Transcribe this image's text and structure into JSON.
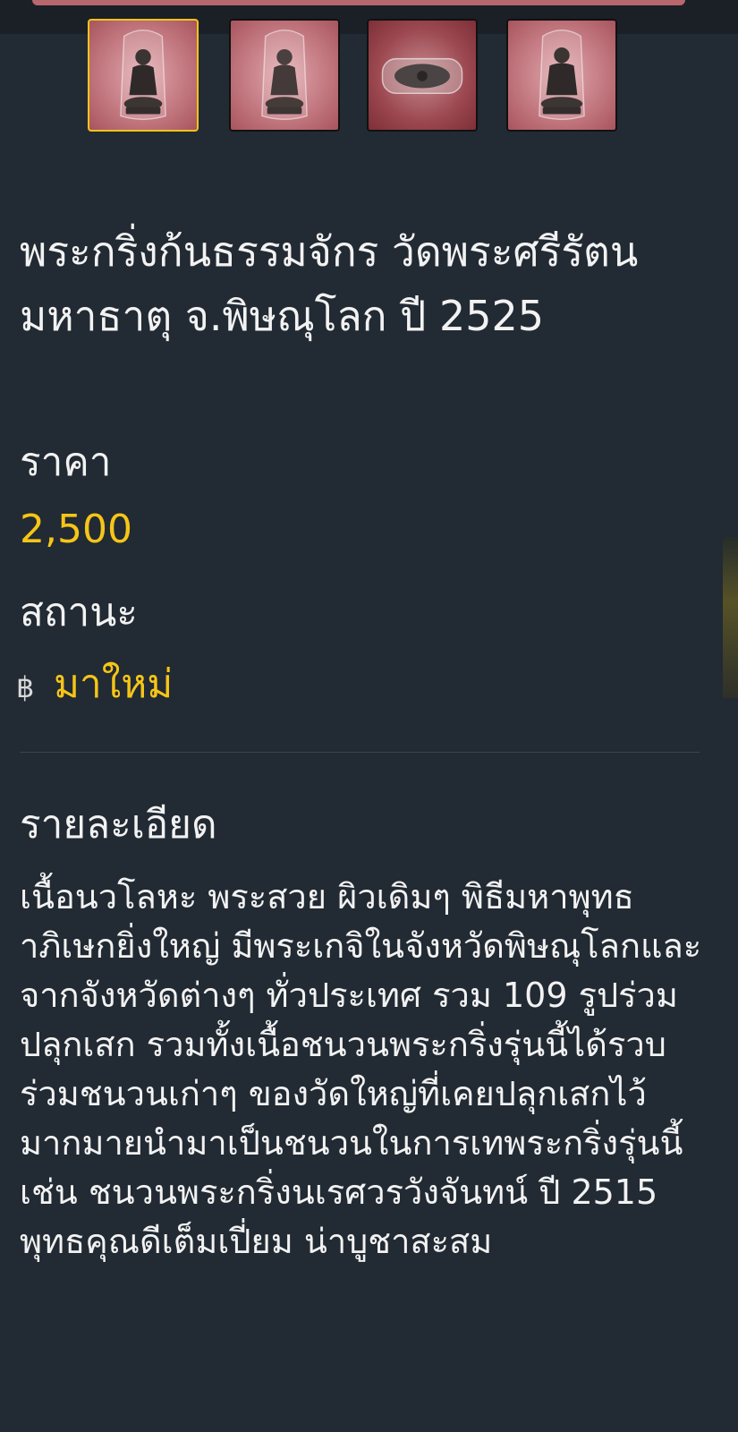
{
  "title": "พระกริ่งก้นธรรมจักร วัดพระศรีรัตนมหาธาตุ จ.พิษณุโลก ปี 2525",
  "price": {
    "label": "ราคา",
    "value": "2,500"
  },
  "status": {
    "label": "สถานะ",
    "currency_symbol": "฿",
    "value": "มาใหม่"
  },
  "details": {
    "label": "รายละเอียด",
    "text": "เนื้อนวโลหะ พระสวย ผิวเดิมๆ พิธีมหาพุทธาภิเษกยิ่งใหญ่ มีพระเกจิในจังหวัดพิษณุโลกและจากจังหวัดต่างๆ ทั่วประเทศ รวม 109 รูปร่วมปลุกเสก รวมทั้งเนื้อชนวนพระกริ่งรุ่นนี้ได้รวบร่วมชนวนเก่าๆ ของวัดใหญ่ที่เคยปลุกเสกไว้มากมายนำมาเป็นชนวนในการเทพระกริ่งรุ่นนี้ เช่น ชนวนพระกริ่งนเรศวรวังจันทน์ ปี 2515 พุทธคุณดีเต็มเปี่ยม น่าบูชาสะสม"
  },
  "thumbnails": [
    {
      "icon": "amulet-front-thumbnail",
      "selected": true
    },
    {
      "icon": "amulet-back-thumbnail",
      "selected": false
    },
    {
      "icon": "amulet-base-thumbnail",
      "selected": false
    },
    {
      "icon": "amulet-side-thumbnail",
      "selected": false
    }
  ],
  "colors": {
    "background": "#222a33",
    "accent": "#f5c518",
    "text": "#f2f2f2"
  }
}
